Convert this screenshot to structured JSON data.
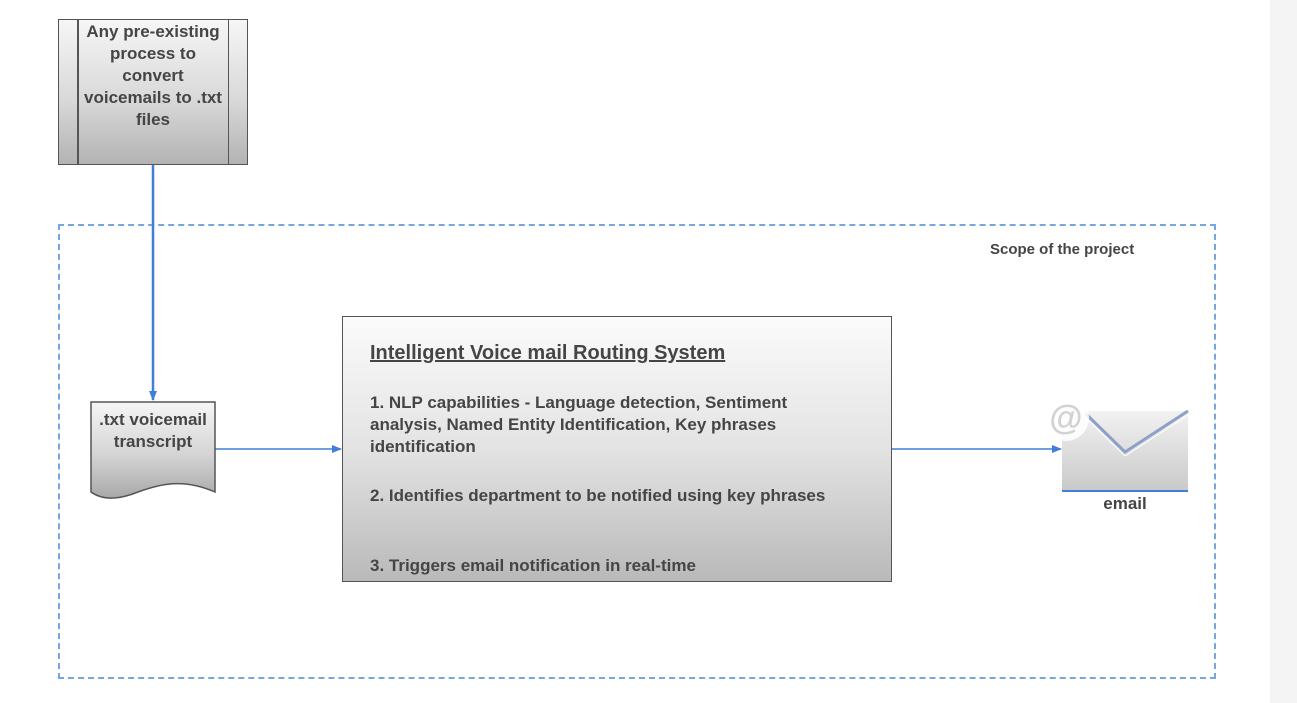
{
  "diagram": {
    "source_process": {
      "label": "Any pre-existing process to convert voicemails to .txt files"
    },
    "scope": {
      "label": "Scope of the project"
    },
    "transcript_document": {
      "label": ".txt voicemail transcript"
    },
    "system": {
      "title": "Intelligent Voice mail Routing System",
      "items": [
        "1. NLP capabilities - Language detection, Sentiment analysis, Named Entity Identification, Key phrases identification",
        "2. Identifies department to be notified using key phrases",
        "3. Triggers email notification in real-time"
      ]
    },
    "output": {
      "label": "email",
      "icon": "email-envelope-at-icon"
    },
    "colors": {
      "arrow": "#3f7fd9",
      "scope_border": "#76a6e0",
      "text": "#454545"
    }
  }
}
